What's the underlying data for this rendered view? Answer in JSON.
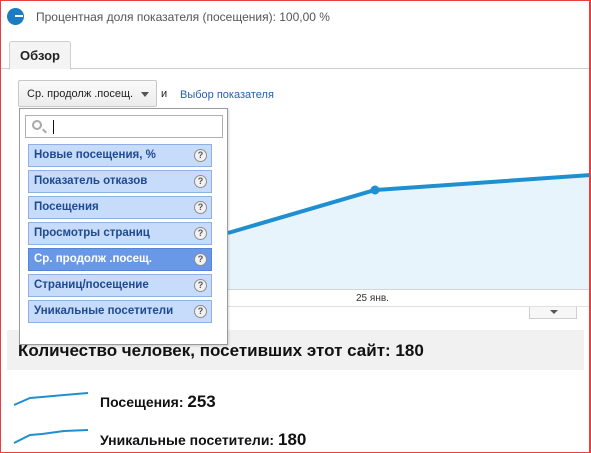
{
  "header": {
    "percent_text": "Процентная доля показателя (посещения): 100,00 %"
  },
  "tabs": [
    {
      "label": "Обзор"
    }
  ],
  "selector": {
    "selected_metric": "Ср. продолж .посещ.",
    "and_text": "и",
    "choose_metric_link": "Выбор показателя"
  },
  "dropdown": {
    "search_value": "",
    "items": [
      {
        "label": "Новые посещения, %",
        "help": "?"
      },
      {
        "label": "Показатель отказов",
        "help": "?"
      },
      {
        "label": "Посещения",
        "help": "?"
      },
      {
        "label": "Просмотры страниц",
        "help": "?"
      },
      {
        "label": "Ср. продолж .посещ.",
        "help": "?",
        "selected": true
      },
      {
        "label": "Страниц/посещение",
        "help": "?"
      },
      {
        "label": "Уникальные посетители",
        "help": "?"
      }
    ]
  },
  "chart": {
    "x_tick_label": "25 янв.",
    "line_color": "#1e8fd0",
    "fill_color": "#e8f4fb"
  },
  "summary": {
    "title": "Количество человек, посетивших этот сайт: 180",
    "stats": [
      {
        "label": "Посещения: ",
        "value": "253"
      },
      {
        "label": "Уникальные посетители: ",
        "value": "180"
      }
    ]
  }
}
